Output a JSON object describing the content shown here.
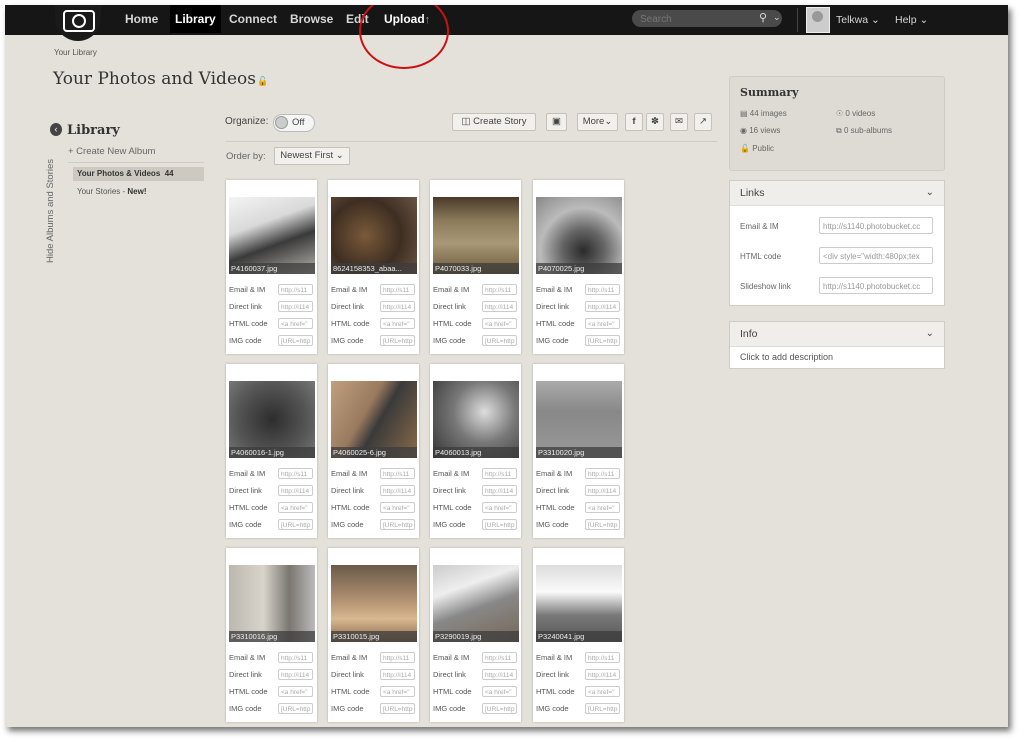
{
  "nav": {
    "items": [
      "Home",
      "Library",
      "Connect",
      "Browse",
      "Edit"
    ],
    "upload": "Upload",
    "upload_arrow": "↑",
    "search_placeholder": "Search",
    "user": "Telkwa",
    "help": "Help"
  },
  "page": {
    "breadcrumb": "Your Library",
    "title": "Your Photos and Videos"
  },
  "sidebar": {
    "vertical_tab": "Hide Albums and Stories",
    "heading": "Library",
    "create": "+ Create New Album",
    "selected_label": "Your Photos & Videos",
    "selected_count": "44",
    "stories": "Your Stories -",
    "stories_new": "New!"
  },
  "toolbar": {
    "organize_label": "Organize:",
    "organize_state": "Off",
    "create_story": "Create Story",
    "more": "More",
    "order_label": "Order by:",
    "order_value": "Newest First"
  },
  "row_labels": {
    "email": "Email & IM",
    "direct": "Direct link",
    "html": "HTML code",
    "img": "IMG code"
  },
  "row_values": {
    "email": "http://s11",
    "direct": "http://i114",
    "html": "<a href=\"",
    "img": "[URL=http"
  },
  "photos": [
    {
      "name": "P4160037.jpg",
      "bg": "linear-gradient(160deg,#f4f4f4 0%,#d9d9d9 35%,#3a3a3a 60%,#b8b4ad 100%)"
    },
    {
      "name": "8624158353_abaa...",
      "bg": "radial-gradient(circle at 40% 50%,#7a5a3a,#3e2e22 55%,#6a5545 100%)"
    },
    {
      "name": "P4070033.jpg",
      "bg": "linear-gradient(180deg,#4a3a2a 0%,#8a7a5a 30%,#a89878 60%,#6a5a3a 100%)"
    },
    {
      "name": "P4070025.jpg",
      "bg": "radial-gradient(circle at 55% 70%,#2a2a2a 0%,#666 30%,#bbb 60%,#888 100%)"
    },
    {
      "name": "P4060016-1.jpg",
      "bg": "radial-gradient(circle at 50% 50%,#2d2d2d,#555 60%,#777 100%)"
    },
    {
      "name": "P4060025-6.jpg",
      "bg": "linear-gradient(120deg,#c0a080 0%,#9a7a5e 40%,#3a3a3a 55%,#8a6a4a 100%)"
    },
    {
      "name": "P4060013.jpg",
      "bg": "radial-gradient(circle at 60% 40%,#ddd,#777 45%,#333 100%)"
    },
    {
      "name": "P3310020.jpg",
      "bg": "linear-gradient(180deg,#aaa 0%,#888 40%,#999 100%)"
    },
    {
      "name": "P3310016.jpg",
      "bg": "linear-gradient(90deg,#bcb8b0 0%,#d8d4cc 40%,#7a7670 70%,#bbb 100%)"
    },
    {
      "name": "P3310015.jpg",
      "bg": "linear-gradient(180deg,#6a5a4a 0%,#b09070 45%,#d8b890 70%,#8a6a4a 100%)"
    },
    {
      "name": "P3290019.jpg",
      "bg": "linear-gradient(160deg,#ccc 0%,#eee 30%,#888 55%,#776655 100%)"
    },
    {
      "name": "P3240041.jpg",
      "bg": "linear-gradient(180deg,#ddd 0%,#fafafa 35%,#7a7a7a 65%,#555 100%)"
    }
  ],
  "summary": {
    "title": "Summary",
    "images": "44 images",
    "videos": "0 videos",
    "views": "16 views",
    "subalbums": "0 sub-albums",
    "privacy": "Public"
  },
  "links": {
    "title": "Links",
    "email_label": "Email & IM",
    "email_value": "http://s1140.photobucket.cc",
    "html_label": "HTML code",
    "html_value": "<div style=\"width:480px;tex",
    "slide_label": "Slideshow link",
    "slide_value": "http://s1140.photobucket.cc"
  },
  "info": {
    "title": "Info",
    "desc": "Click to add description"
  }
}
